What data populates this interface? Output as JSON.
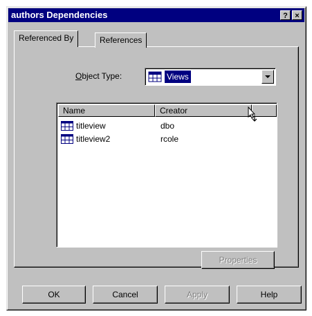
{
  "window": {
    "title": "authors Dependencies",
    "help_button": "?",
    "close_button": "×"
  },
  "tabs": [
    {
      "label": "Referenced By",
      "active": true
    },
    {
      "label": "References",
      "active": false
    }
  ],
  "object_type": {
    "label_prefix": "O",
    "label_rest": "bject Type:",
    "selected": "Views",
    "icon": "view-icon"
  },
  "list": {
    "columns": [
      "Name",
      "Creator"
    ],
    "rows": [
      {
        "name": "titleview",
        "creator": "dbo",
        "icon": "view-icon"
      },
      {
        "name": "titleview2",
        "creator": "rcole",
        "icon": "view-icon"
      }
    ]
  },
  "buttons": {
    "properties": "Properties",
    "ok": "OK",
    "cancel": "Cancel",
    "apply": "Apply",
    "help": "Help"
  },
  "colors": {
    "titlebar": "#000080",
    "face": "#c0c0c0",
    "selection": "#000080"
  }
}
